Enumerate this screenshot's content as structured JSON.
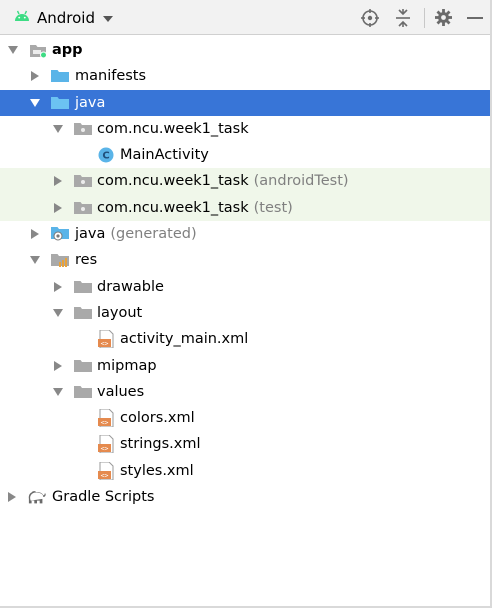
{
  "toolbar": {
    "title": "Android",
    "icons": [
      "android-icon",
      "dropdown-caret-icon",
      "crosshair-icon",
      "collapse-icon",
      "gear-icon",
      "minimize-icon"
    ]
  },
  "tree": {
    "app": "app",
    "manifests": "manifests",
    "java": "java",
    "pkg_main": "com.ncu.week1_task",
    "main_activity": "MainActivity",
    "pkg_android_test": "com.ncu.week1_task",
    "pkg_android_test_suffix": "(androidTest)",
    "pkg_test": "com.ncu.week1_task",
    "pkg_test_suffix": "(test)",
    "java_generated": "java",
    "java_generated_suffix": "(generated)",
    "res": "res",
    "drawable": "drawable",
    "layout": "layout",
    "activity_main": "activity_main.xml",
    "mipmap": "mipmap",
    "values": "values",
    "colors": "colors.xml",
    "strings": "strings.xml",
    "styles": "styles.xml",
    "gradle_scripts": "Gradle Scripts"
  },
  "colors": {
    "selection": "#3875d7",
    "test_background": "#f0f7ea",
    "folder_blue": "#5ab4e8",
    "android_green": "#3ddc84",
    "xml_orange": "#e58a4e"
  }
}
